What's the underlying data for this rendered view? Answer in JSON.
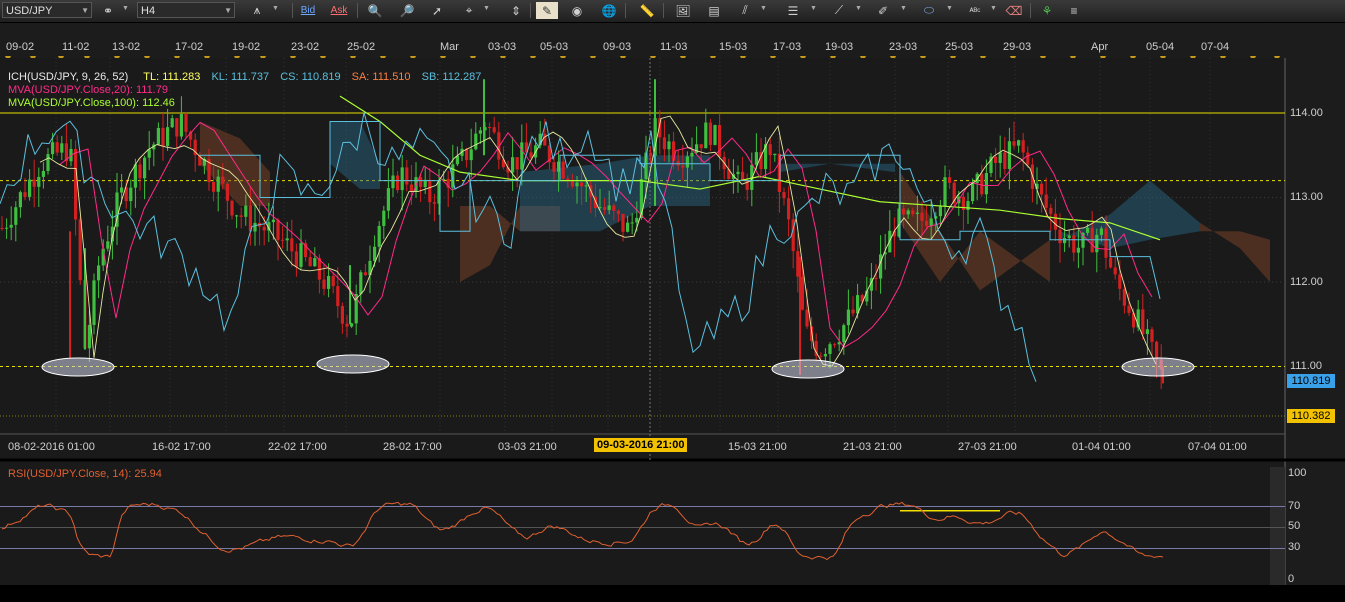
{
  "toolbar": {
    "symbol": "USD/JPY",
    "timeframe": "H4",
    "bid_label": "Bid",
    "ask_label": "Ask"
  },
  "top_dates": [
    "09-02",
    "11-02",
    "13-02",
    "17-02",
    "19-02",
    "23-02",
    "25-02",
    "Mar",
    "03-03",
    "05-03",
    "09-03",
    "11-03",
    "15-03",
    "17-03",
    "19-03",
    "23-03",
    "25-03",
    "29-03",
    "Apr",
    "05-04",
    "07-04"
  ],
  "legend": {
    "ich": {
      "name": "ICH(USD/JPY, 9, 26, 52)",
      "tl": "TL: 111.283",
      "kl": "KL: 111.737",
      "cs": "CS: 110.819",
      "sa": "SA: 111.510",
      "sb": "SB: 112.287"
    },
    "mva20": "MVA(USD/JPY.Close,20): 111.79",
    "mva100": "MVA(USD/JPY.Close,100): 112.46"
  },
  "price_axis": [
    "114.00",
    "113.00",
    "112.00",
    "111.00"
  ],
  "price_tags": {
    "current": "110.819",
    "low": "110.382"
  },
  "time_axis": [
    "08-02-2016 01:00",
    "16-02 17:00",
    "22-02 17:00",
    "28-02 17:00",
    "03-03 21:00",
    "15-03 21:00",
    "21-03 21:00",
    "27-03 21:00",
    "01-04 01:00",
    "07-04 01:00"
  ],
  "time_cursor": "09-03-2016 21:00",
  "rsi": {
    "legend": "RSI(USD/JPY.Close, 14): 25.94",
    "axis": [
      "100",
      "70",
      "50",
      "30",
      "0"
    ]
  },
  "colors": {
    "ich_label": "#e8e8e8",
    "tl": "#ffff66",
    "kl": "#5bc0de",
    "cs": "#5bc0de",
    "sa": "#ff7f3f",
    "sb": "#5bc0de",
    "mva20": "#ff2a8a",
    "mva100": "#aaff33",
    "bull": "#3fbf3f",
    "bear": "#d42020",
    "rsi": "#e06030",
    "tag_current": "#3aa0e8",
    "tag_low": "#f2c200"
  }
}
